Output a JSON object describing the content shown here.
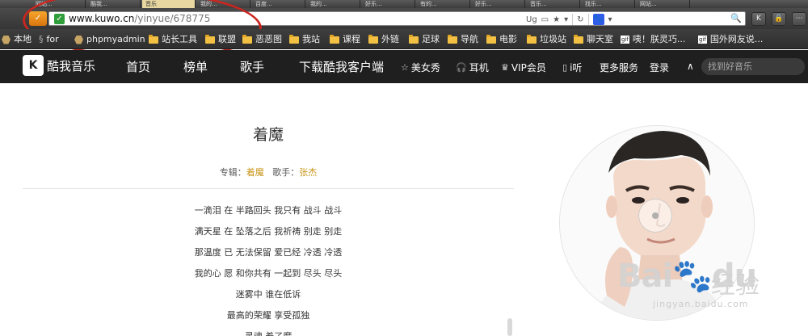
{
  "browser": {
    "tabs": [
      "网站...",
      "酷我...",
      "音乐",
      "我的...",
      "百度...",
      "我的...",
      "好乐...",
      "有的...",
      "好乐...",
      "音乐...",
      "找乐...",
      "网站..."
    ],
    "url_host": "www.kuwo.cn",
    "url_path": "/yinyue/678775",
    "url_tools": [
      "Ug",
      "★"
    ],
    "buttons": [
      "K",
      "🔒",
      "⋯"
    ]
  },
  "bookmarks": [
    {
      "label": "本地",
      "icon": "hex-icon"
    },
    {
      "label": "for",
      "icon": "s-icon"
    },
    {
      "label": "phpmyadmin",
      "icon": "hex-icon"
    },
    {
      "label": "站长工具",
      "icon": "folder-icon"
    },
    {
      "label": "联盟",
      "icon": "folder-icon"
    },
    {
      "label": "恶恶图",
      "icon": "folder-icon"
    },
    {
      "label": "我站",
      "icon": "folder-icon"
    },
    {
      "label": "课程",
      "icon": "folder-icon"
    },
    {
      "label": "外链",
      "icon": "folder-icon"
    },
    {
      "label": "足球",
      "icon": "folder-icon"
    },
    {
      "label": "导航",
      "icon": "folder-icon"
    },
    {
      "label": "电影",
      "icon": "folder-icon"
    },
    {
      "label": "垃圾站",
      "icon": "folder-icon"
    },
    {
      "label": "聊天室",
      "icon": "folder-icon"
    },
    {
      "label": "咦！朕灵巧...",
      "icon": "gif-icon"
    },
    {
      "label": "国外网友说...",
      "icon": "gif-icon"
    }
  ],
  "site": {
    "logo_text": "酷我音乐",
    "logo_mark": "K",
    "nav": [
      "首页",
      "榜单",
      "歌手",
      "下载酷我客户端"
    ],
    "nav_small": [
      {
        "label": "美女秀",
        "icon": "star-icon"
      },
      {
        "label": "耳机",
        "icon": "headphone-icon"
      },
      {
        "label": "VIP会员",
        "icon": "crown-icon"
      },
      {
        "label": "i听",
        "icon": "phone-icon"
      },
      {
        "label": "更多服务",
        "icon": ""
      },
      {
        "label": "登录",
        "icon": ""
      }
    ],
    "search_placeholder": "找到好音乐"
  },
  "song": {
    "title": "着魔",
    "album_label": "专辑：",
    "album": "着魔",
    "singer_label": "歌手：",
    "singer": "张杰",
    "lyrics": [
      "一滴泪 在 半路回头 我只有 战斗 战斗",
      "满天星 在 坠落之后 我祈祷 别走 别走",
      "那温度 已 无法保留 爱已经 冷透 冷透",
      "我的心 愿 和你共有 一起到 尽头 尽头",
      "迷雾中 谁在低诉",
      "最高的荣耀 享受孤独",
      "灵魂 着了魔"
    ]
  },
  "watermark": {
    "brand": "Bai",
    "brand2": "du",
    "cn": "经验",
    "sub": "jingyan.baidu.com"
  }
}
